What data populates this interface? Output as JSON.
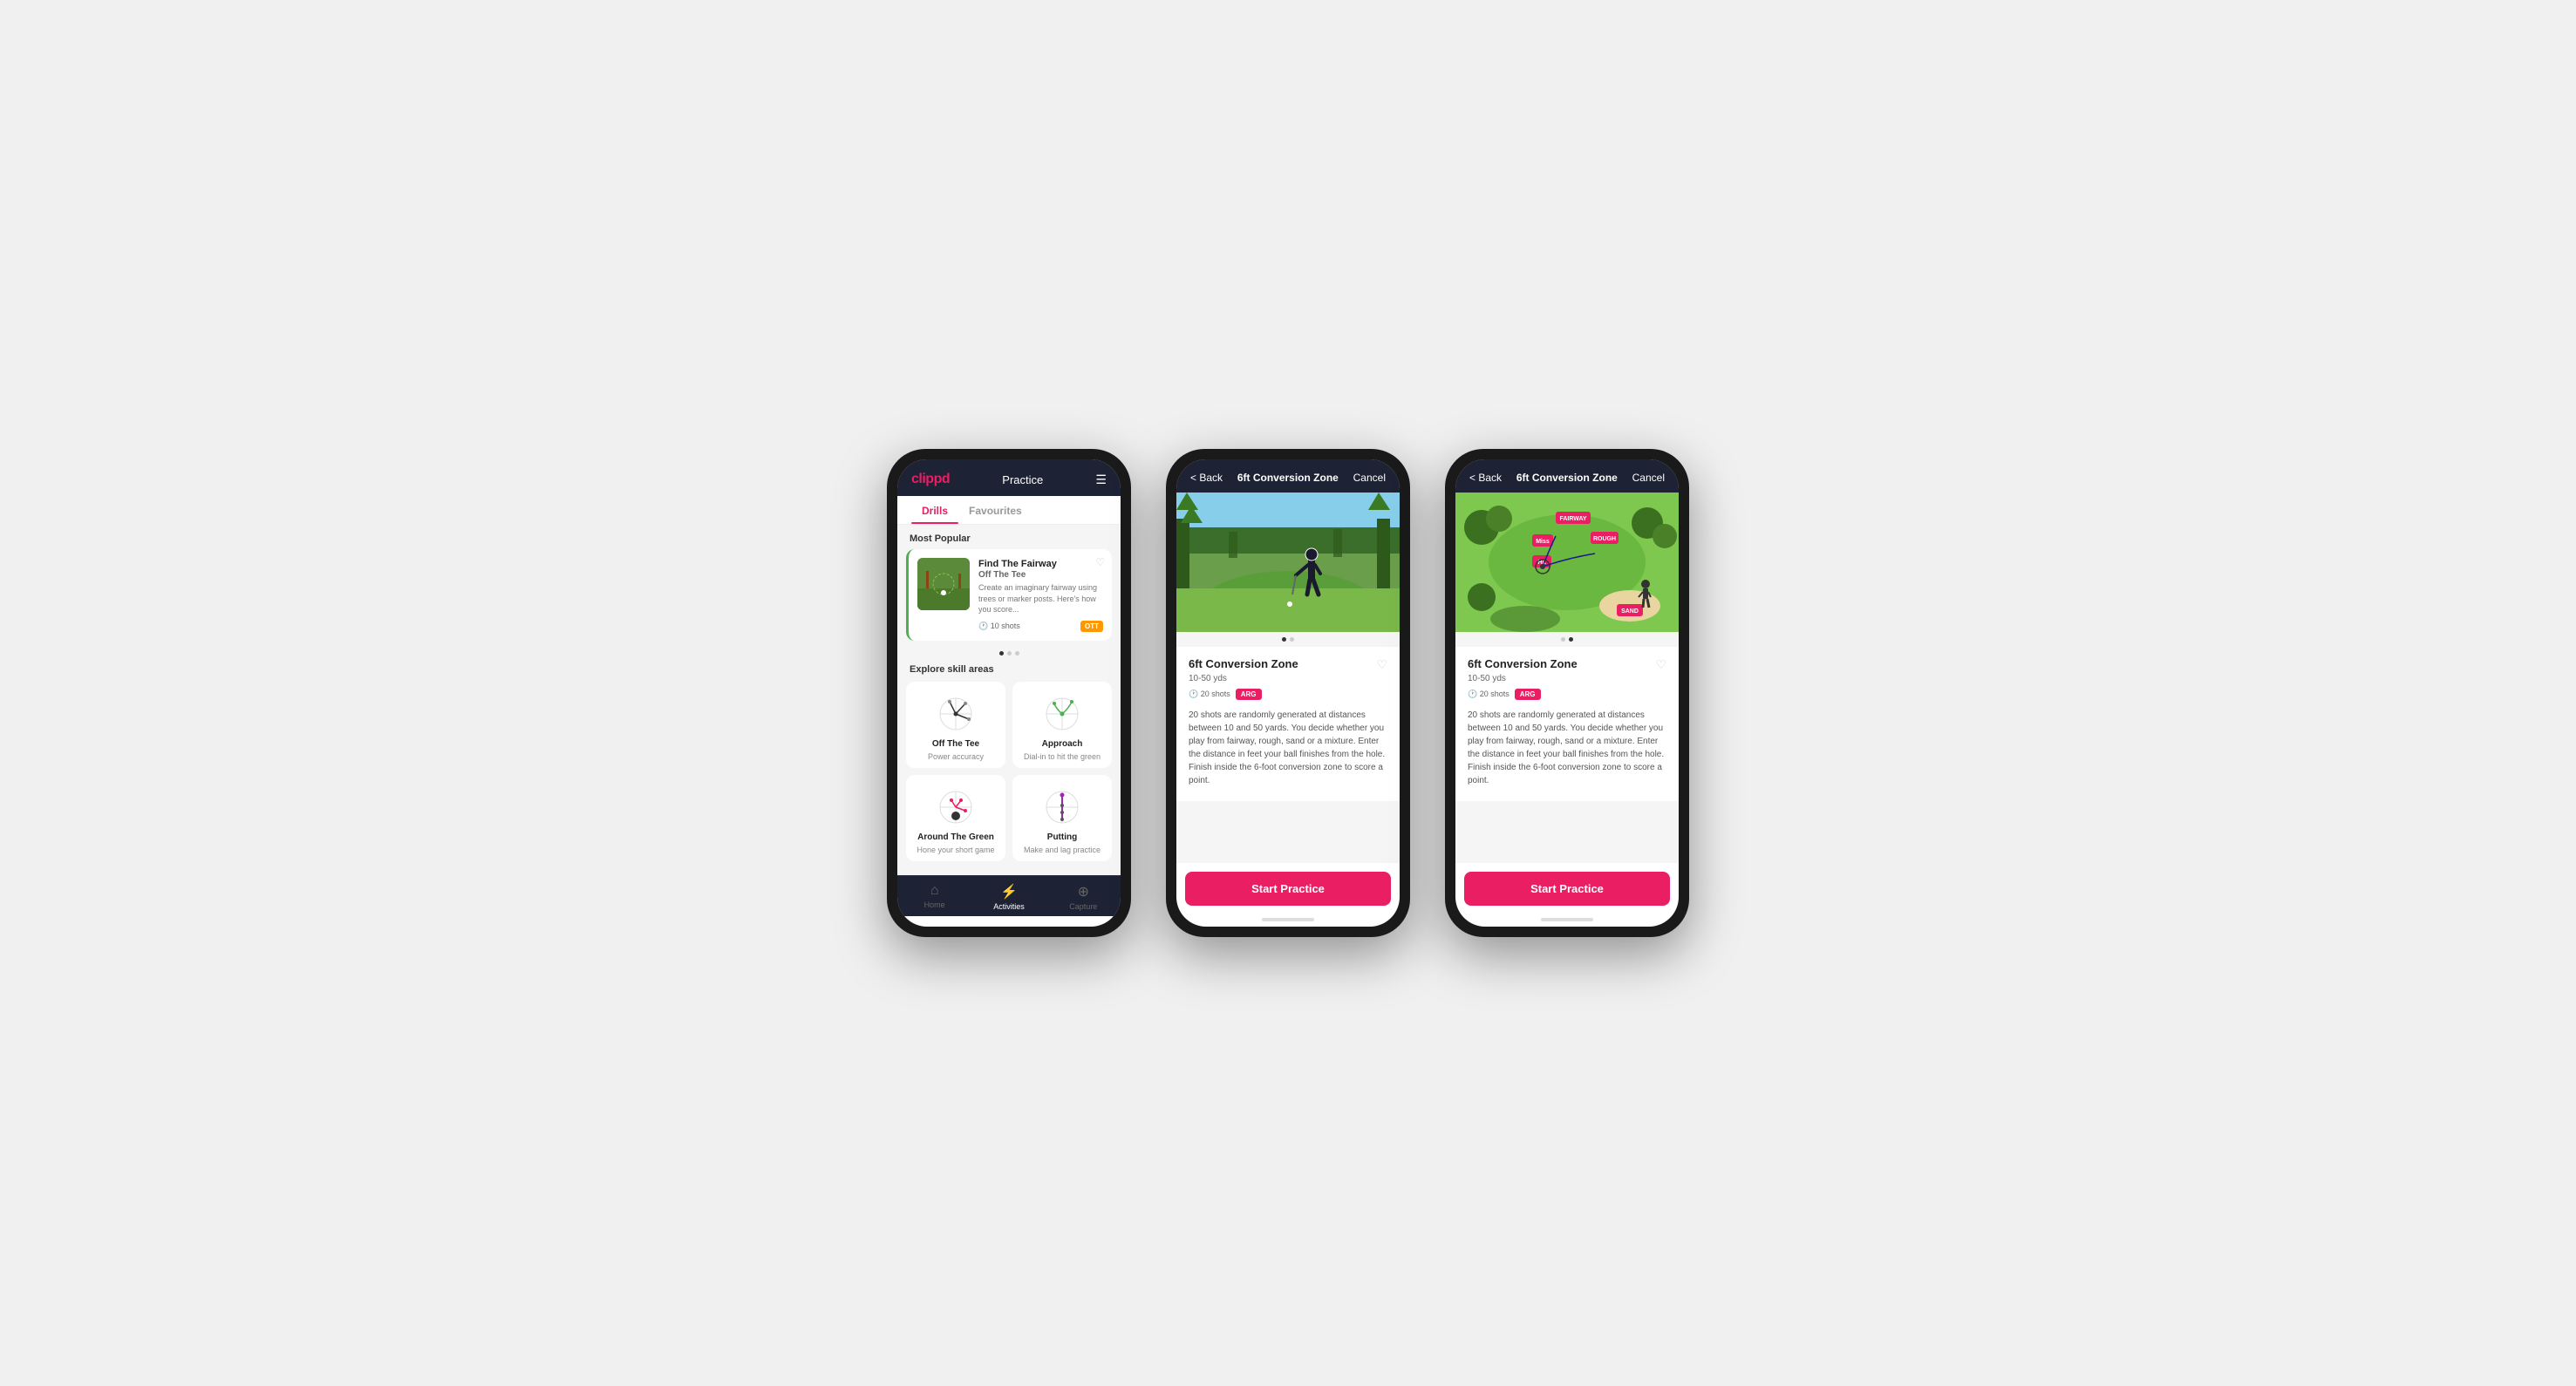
{
  "phone1": {
    "header": {
      "logo": "clippd",
      "title": "Practice",
      "menu_icon": "☰"
    },
    "tabs": [
      {
        "label": "Drills",
        "active": true
      },
      {
        "label": "Favourites",
        "active": false
      }
    ],
    "most_popular_label": "Most Popular",
    "card": {
      "title": "Find The Fairway",
      "subtitle": "Off The Tee",
      "description": "Create an imaginary fairway using trees or marker posts. Here's how you score...",
      "shots": "10 shots",
      "badge": "OTT",
      "fav_icon": "♡"
    },
    "explore_label": "Explore skill areas",
    "skills": [
      {
        "name": "Off The Tee",
        "desc": "Power accuracy"
      },
      {
        "name": "Approach",
        "desc": "Dial-in to hit the green"
      },
      {
        "name": "Around The Green",
        "desc": "Hone your short game"
      },
      {
        "name": "Putting",
        "desc": "Make and lag practice"
      }
    ],
    "nav": [
      {
        "label": "Home",
        "icon": "⌂",
        "active": false
      },
      {
        "label": "Activities",
        "icon": "⚡",
        "active": true
      },
      {
        "label": "Capture",
        "icon": "⊕",
        "active": false
      }
    ]
  },
  "phone2": {
    "header": {
      "back_label": "< Back",
      "title": "6ft Conversion Zone",
      "cancel_label": "Cancel"
    },
    "drill": {
      "title": "6ft Conversion Zone",
      "yardage": "10-50 yds",
      "shots": "20 shots",
      "badge": "ARG",
      "fav_icon": "♡",
      "description": "20 shots are randomly generated at distances between 10 and 50 yards. You decide whether you play from fairway, rough, sand or a mixture. Enter the distance in feet your ball finishes from the hole. Finish inside the 6-foot conversion zone to score a point.",
      "start_btn": "Start Practice"
    }
  },
  "phone3": {
    "header": {
      "back_label": "< Back",
      "title": "6ft Conversion Zone",
      "cancel_label": "Cancel"
    },
    "drill": {
      "title": "6ft Conversion Zone",
      "yardage": "10-50 yds",
      "shots": "20 shots",
      "badge": "ARG",
      "fav_icon": "♡",
      "description": "20 shots are randomly generated at distances between 10 and 50 yards. You decide whether you play from fairway, rough, sand or a mixture. Enter the distance in feet your ball finishes from the hole. Finish inside the 6-foot conversion zone to score a point.",
      "start_btn": "Start Practice"
    }
  }
}
